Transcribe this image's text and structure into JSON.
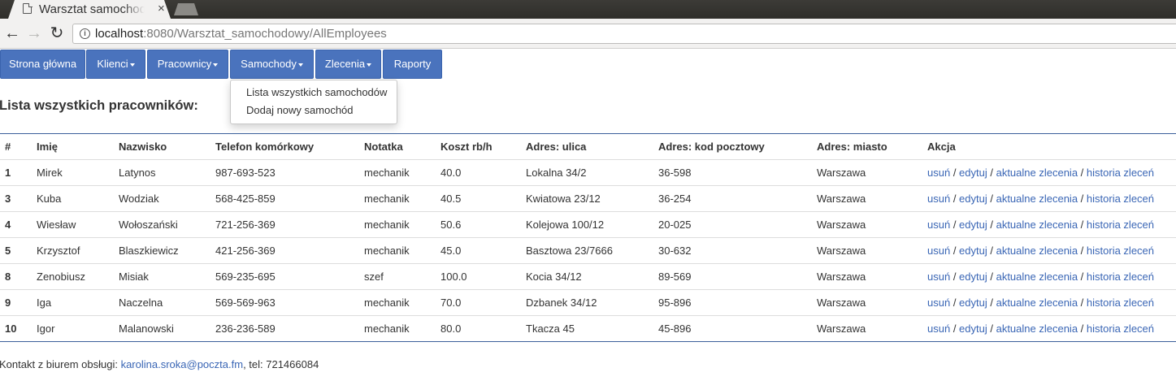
{
  "browser": {
    "tab_title": "Warsztat samochodowy",
    "tab_close": "×",
    "url_host": "localhost",
    "url_rest": ":8080/Warsztat_samochodowy/AllEmployees",
    "back_icon": "←",
    "forward_icon": "→",
    "reload_icon": "↻"
  },
  "navbar": {
    "items": [
      {
        "label": "Strona główna",
        "dropdown": false
      },
      {
        "label": "Klienci",
        "dropdown": true
      },
      {
        "label": "Pracownicy",
        "dropdown": true
      },
      {
        "label": "Samochody",
        "dropdown": true
      },
      {
        "label": "Zlecenia",
        "dropdown": true
      },
      {
        "label": "Raporty",
        "dropdown": false
      }
    ]
  },
  "dropdown": {
    "items": [
      "Lista wszystkich samochodów",
      "Dodaj nowy samochód"
    ]
  },
  "heading": "Lista wszystkich pracowników:",
  "table": {
    "columns": [
      "#",
      "Imię",
      "Nazwisko",
      "Telefon komórkowy",
      "Notatka",
      "Koszt rb/h",
      "Adres: ulica",
      "Adres: kod pocztowy",
      "Adres: miasto",
      "Akcja"
    ],
    "actions": [
      "usuń",
      "edytuj",
      "aktualne zlecenia",
      "historia zleceń"
    ],
    "action_separator": " / ",
    "rows": [
      [
        "1",
        "Mirek",
        "Latynos",
        "987-693-523",
        "mechanik",
        "40.0",
        "Lokalna 34/2",
        "36-598",
        "Warszawa"
      ],
      [
        "3",
        "Kuba",
        "Wodziak",
        "568-425-859",
        "mechanik",
        "40.5",
        "Kwiatowa 23/12",
        "36-254",
        "Warszawa"
      ],
      [
        "4",
        "Wiesław",
        "Wołoszański",
        "721-256-369",
        "mechanik",
        "50.6",
        "Kolejowa 100/12",
        "20-025",
        "Warszawa"
      ],
      [
        "5",
        "Krzysztof",
        "Blaszkiewicz",
        "421-256-369",
        "mechanik",
        "45.0",
        "Basztowa 23/7666",
        "30-632",
        "Warszawa"
      ],
      [
        "8",
        "Zenobiusz",
        "Misiak",
        "569-235-695",
        "szef",
        "100.0",
        "Kocia 34/12",
        "89-569",
        "Warszawa"
      ],
      [
        "9",
        "Iga",
        "Naczelna",
        "569-569-963",
        "mechanik",
        "70.0",
        "Dzbanek 34/12",
        "95-896",
        "Warszawa"
      ],
      [
        "10",
        "Igor",
        "Malanowski",
        "236-236-589",
        "mechanik",
        "80.0",
        "Tkacza 45",
        "45-896",
        "Warszawa"
      ]
    ]
  },
  "footer": {
    "prefix": "Kontakt z biurem obsługi: ",
    "email": "karolina.sroka@poczta.fm",
    "suffix": ", tel: 721466084"
  },
  "colors": {
    "nav_bg": "#4a73bd",
    "link": "#3a66b5",
    "table_border": "#3b5f9a"
  }
}
